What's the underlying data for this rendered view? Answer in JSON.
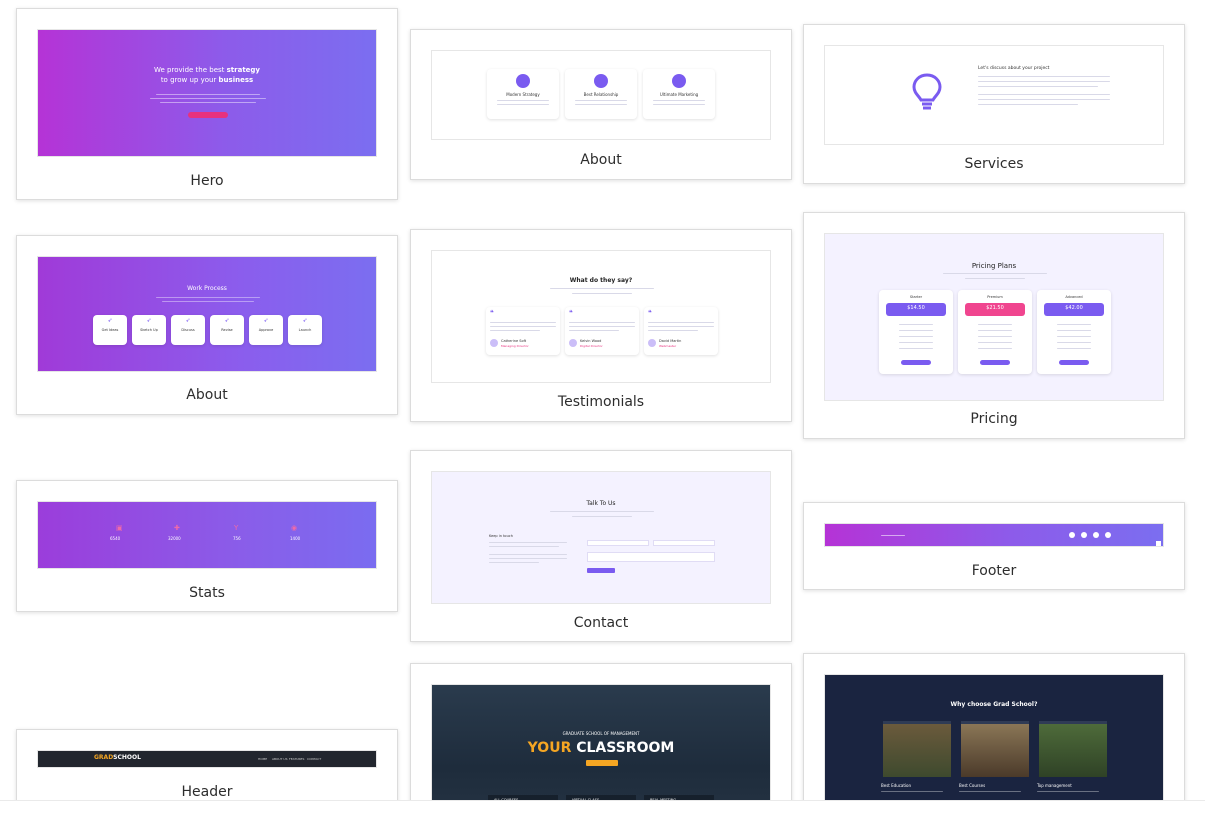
{
  "colors": {
    "accent": "#7a5bf0",
    "pink": "#e8317e",
    "gradient_start": "#b533d6",
    "gradient_end": "#7b6ef0",
    "navy": "#1a2440",
    "orange": "#f5a623"
  },
  "cards": {
    "hero": {
      "label": "Hero",
      "heading_a": "We provide the best",
      "heading_em": "strategy",
      "heading_b": "to grow up your",
      "heading_em2": "business"
    },
    "about_features": {
      "label": "About",
      "features": [
        "Modern Strategy",
        "Best Relationship",
        "Ultimate Marketing"
      ]
    },
    "services": {
      "label": "Services",
      "heading": "Let's discuss about your project",
      "icon": "lightbulb-icon"
    },
    "work_process": {
      "label": "About",
      "heading": "Work Process",
      "steps": [
        "Get Ideas",
        "Sketch Up",
        "Discuss",
        "Revise",
        "Approve",
        "Launch"
      ]
    },
    "testimonials": {
      "label": "Testimonials",
      "heading": "What do they say?",
      "people": [
        {
          "name": "Catherine Soft",
          "role": "Managing Director"
        },
        {
          "name": "Kelvin Wood",
          "role": "Digital Director"
        },
        {
          "name": "David Martin",
          "role": "Webmaster"
        }
      ]
    },
    "pricing": {
      "label": "Pricing",
      "heading": "Pricing Plans",
      "plans": [
        {
          "name": "Starter",
          "price": "$14.50"
        },
        {
          "name": "Premium",
          "price": "$21.50"
        },
        {
          "name": "Advanced",
          "price": "$42.00"
        }
      ]
    },
    "stats": {
      "label": "Stats",
      "values": [
        "6540",
        "32000",
        "756",
        "1400"
      ]
    },
    "contact": {
      "label": "Contact",
      "heading": "Talk To Us",
      "side_heading": "Keep in touch"
    },
    "footer": {
      "label": "Footer"
    },
    "header": {
      "label": "Header",
      "logo_a": "GRAD",
      "logo_b": "SCHOOL",
      "nav": [
        "HOME",
        "ABOUT US",
        "FEATURES",
        "CONTACT"
      ]
    },
    "classroom": {
      "eyebrow": "GRADUATE SCHOOL OF MANAGEMENT",
      "title_a": "YOUR",
      "title_b": "CLASSROOM",
      "tiles": [
        "ALL COURSES",
        "VIRTUAL CLASS",
        "REAL MEETING"
      ]
    },
    "grad_school": {
      "heading": "Why choose Grad School?",
      "items": [
        "Best Education",
        "Best Courses",
        "Top management"
      ]
    }
  }
}
